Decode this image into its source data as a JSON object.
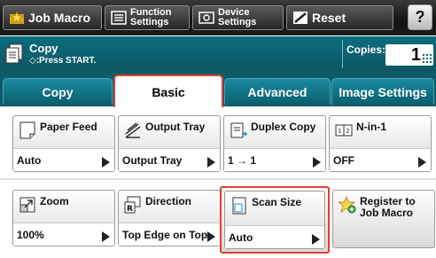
{
  "toolbar": {
    "job_macro": "Job Macro",
    "function_settings_1": "Function",
    "function_settings_2": "Settings",
    "device_settings_1": "Device",
    "device_settings_2": "Settings",
    "reset": "Reset",
    "help": "?"
  },
  "status": {
    "mode": "Copy",
    "hint": "◇:Press START.",
    "copies_label": "Copies:",
    "copies_value": "1"
  },
  "tabs": [
    {
      "label": "Copy"
    },
    {
      "label": "Basic",
      "active": true
    },
    {
      "label": "Advanced"
    },
    {
      "label": "Image Settings"
    }
  ],
  "settings": {
    "paper_feed": {
      "title": "Paper Feed",
      "value": "Auto"
    },
    "output_tray": {
      "title": "Output Tray",
      "value": "Output Tray"
    },
    "duplex_copy": {
      "title": "Duplex Copy",
      "value": "1 → 1"
    },
    "n_in_1": {
      "title": "N-in-1",
      "value": "OFF",
      "icon_text": "1 2"
    },
    "zoom": {
      "title": "Zoom",
      "value": "100%"
    },
    "direction": {
      "title": "Direction",
      "value": "Top Edge on Top"
    },
    "scan_size": {
      "title": "Scan Size",
      "value": "Auto"
    },
    "register_macro": {
      "title_1": "Register to",
      "title_2": "Job Macro"
    }
  },
  "colors": {
    "accent": "#0b6473",
    "highlight": "#e04030",
    "toolbar": "#1a1a1a"
  }
}
